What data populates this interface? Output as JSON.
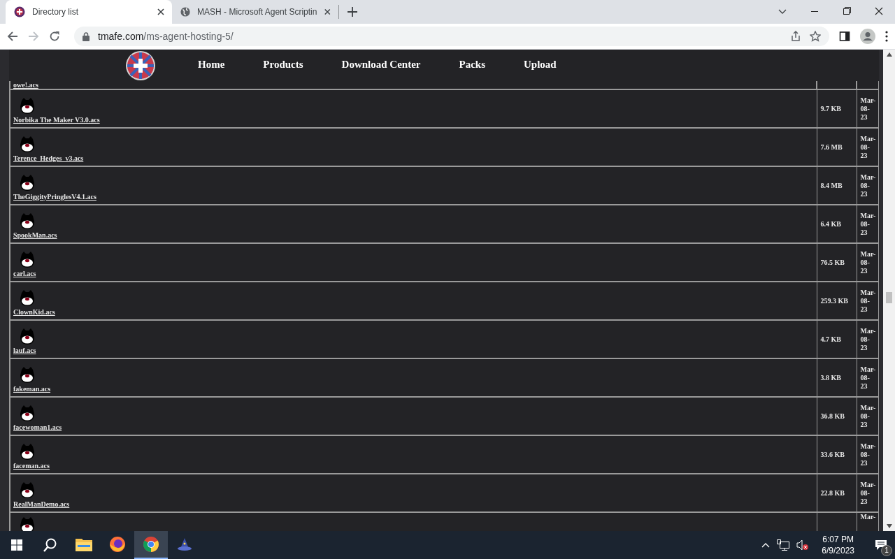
{
  "browser": {
    "tabs": [
      {
        "title": "Directory list",
        "kind": "site",
        "selected": true
      },
      {
        "title": "MASH - Microsoft Agent Scriptin",
        "kind": "globe",
        "selected": false
      }
    ],
    "address": {
      "host": "tmafe.com",
      "path": "/ms-agent-hosting-5/"
    }
  },
  "site": {
    "nav": [
      {
        "label": "Home"
      },
      {
        "label": "Products"
      },
      {
        "label": "Download Center"
      },
      {
        "label": "Packs"
      },
      {
        "label": "Upload"
      }
    ]
  },
  "files": {
    "rows": [
      {
        "name": "owe!.acs",
        "kind": "partial-top"
      },
      {
        "name": "Norbika The Maker V3.0.acs",
        "size": "9.7 KB",
        "date": "Mar-08-23",
        "kind": "full"
      },
      {
        "name": "Terence_Hedges_v3.acs",
        "size": "7.6 MB",
        "date": "Mar-08-23",
        "kind": "full"
      },
      {
        "name": "TheGiggityPringlesV4.1.acs",
        "size": "8.4 MB",
        "date": "Mar-08-23",
        "kind": "full"
      },
      {
        "name": "SpookMan.acs",
        "size": "6.4 KB",
        "date": "Mar-08-23",
        "kind": "full"
      },
      {
        "name": "carl.acs",
        "size": "76.5 KB",
        "date": "Mar-08-23",
        "kind": "full"
      },
      {
        "name": "ClownKid.acs",
        "size": "259.3 KB",
        "date": "Mar-08-23",
        "kind": "full"
      },
      {
        "name": "lauf.acs",
        "size": "4.7 KB",
        "date": "Mar-08-23",
        "kind": "full"
      },
      {
        "name": "fakeman.acs",
        "size": "3.8 KB",
        "date": "Mar-08-23",
        "kind": "full"
      },
      {
        "name": "facewoman1.acs",
        "size": "36.8 KB",
        "date": "Mar-08-23",
        "kind": "full"
      },
      {
        "name": "faceman.acs",
        "size": "33.6 KB",
        "date": "Mar-08-23",
        "kind": "full"
      },
      {
        "name": "RealManDemo.acs",
        "size": "22.8 KB",
        "date": "Mar-08-23",
        "kind": "full"
      },
      {
        "date": "Mar-",
        "kind": "partial-bottom"
      }
    ]
  },
  "taskbar": {
    "apps": [
      {
        "kind": "explorer",
        "active": false
      },
      {
        "kind": "firefox",
        "active": false
      },
      {
        "kind": "chrome",
        "active": true
      },
      {
        "kind": "agent",
        "active": false
      }
    ],
    "time": "6:07 PM",
    "date": "6/9/2023",
    "notifications": "1"
  }
}
